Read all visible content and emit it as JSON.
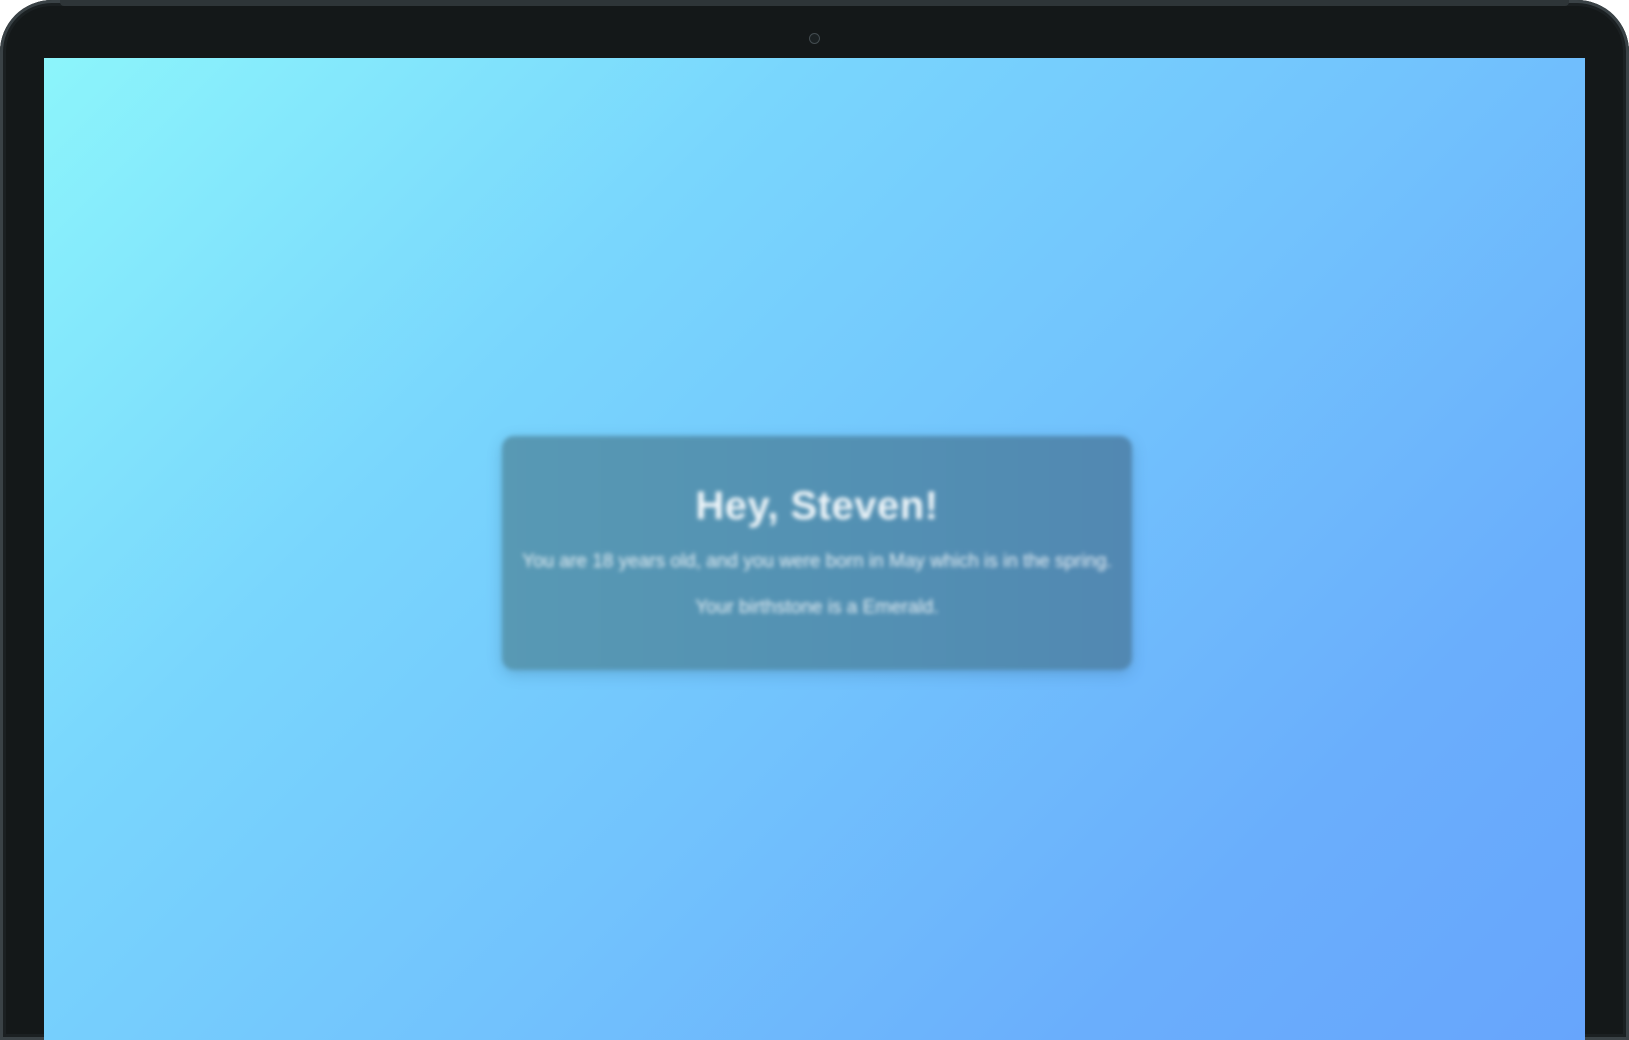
{
  "greeting": {
    "title": "Hey, Steven!",
    "line1": "You are 18 years old, and you were born in May which is in the spring.",
    "line2": "Your birthstone is a Emerald."
  },
  "colors": {
    "frame": "#141819",
    "gradient_start": "#8cf5fb",
    "gradient_end": "#67a5fc",
    "card": "#5390b3",
    "text": "#f4f8fb"
  },
  "icons": {
    "camera": "webcam-icon"
  }
}
